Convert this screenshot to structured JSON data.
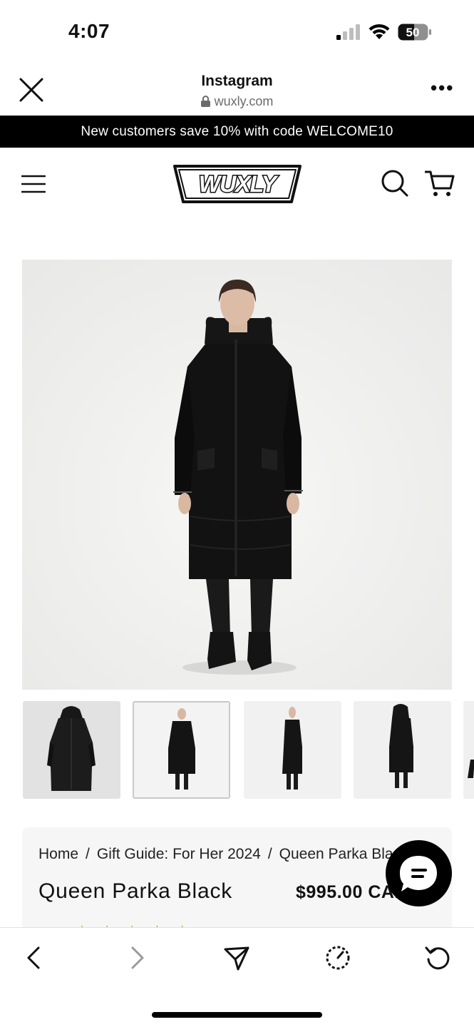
{
  "status_bar": {
    "time": "4:07",
    "battery": "50"
  },
  "browser": {
    "title": "Instagram",
    "url": "wuxly.com"
  },
  "promo": {
    "text": "New customers save 10% with code WELCOME10"
  },
  "site_nav": {
    "logo": "WUXLY"
  },
  "product": {
    "breadcrumb": [
      "Home",
      "Gift Guide: For Her 2024",
      "Queen Parka Black"
    ],
    "breadcrumb_separator": "/",
    "title": "Queen Parka Black",
    "price": "$995.00 CAD",
    "stars": "★★★★★"
  },
  "gallery": {
    "thumbnails": [
      "front-hood-up",
      "front-model",
      "side-model",
      "back-model",
      "side-partial"
    ],
    "selected_index": 1
  },
  "toolbar": {
    "items": [
      "back",
      "forward",
      "share",
      "speed",
      "reload"
    ]
  },
  "colors": {
    "promo_bg": "#000000",
    "promo_text": "#ffffff",
    "star": "#d89a2b",
    "card_bg": "#f6f6f6"
  }
}
